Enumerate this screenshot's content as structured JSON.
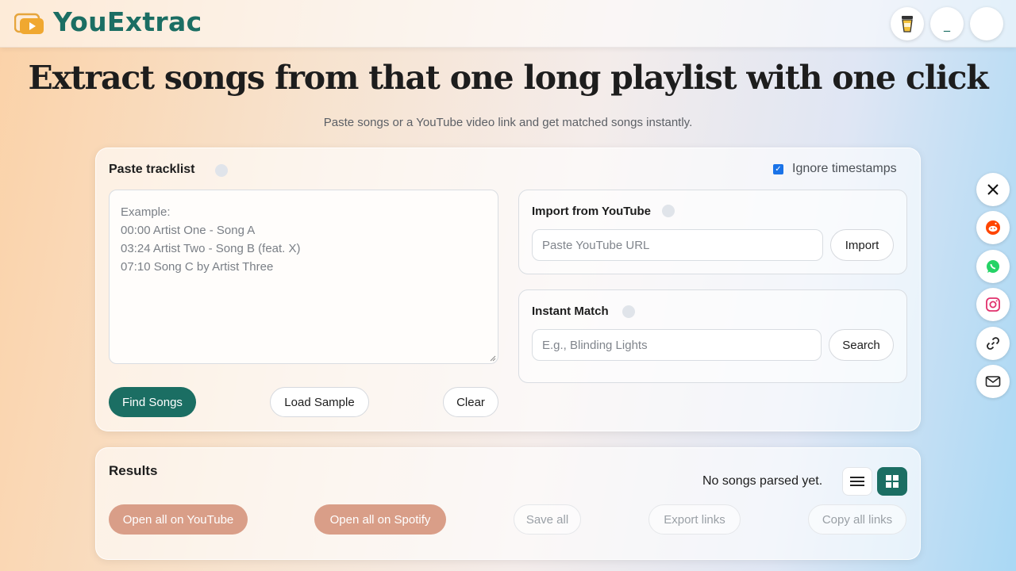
{
  "app": {
    "name": "YouExtrac"
  },
  "header": {
    "buttons": [
      "cup-icon",
      "minimize-icon",
      "blank-icon"
    ],
    "minimize_glyph": "_"
  },
  "hero": {
    "title": "Extract songs from that one long playlist with one click",
    "subtitle": "Paste songs or a YouTube video link and get matched songs instantly."
  },
  "tracklist": {
    "title": "Paste tracklist",
    "ignore_timestamps_label": "Ignore timestamps",
    "ignore_timestamps_checked": true,
    "placeholder_lines": [
      "Example:",
      "00:00 Artist One - Song A",
      "03:24 Artist Two - Song B (feat. X)",
      "07:10 Song C by Artist Three"
    ],
    "find_songs": "Find Songs",
    "load_sample": "Load Sample",
    "clear": "Clear"
  },
  "youtube_import": {
    "title": "Import from YouTube",
    "placeholder": "Paste YouTube URL",
    "button": "Import"
  },
  "instant_match": {
    "title": "Instant Match",
    "placeholder": "E.g., Blinding Lights",
    "button": "Search"
  },
  "results": {
    "title": "Results",
    "status": "No songs parsed yet.",
    "actions": {
      "open_youtube": "Open all on YouTube",
      "open_spotify": "Open all on Spotify",
      "save_all": "Save all",
      "export_links": "Export links",
      "copy_links": "Copy all links"
    }
  },
  "social": [
    "x-icon",
    "reddit-icon",
    "whatsapp-icon",
    "instagram-icon",
    "link-icon",
    "mail-icon"
  ],
  "colors": {
    "brand": "#1b6e63",
    "peach": "#d99e88",
    "checkbox": "#1a73e8"
  }
}
